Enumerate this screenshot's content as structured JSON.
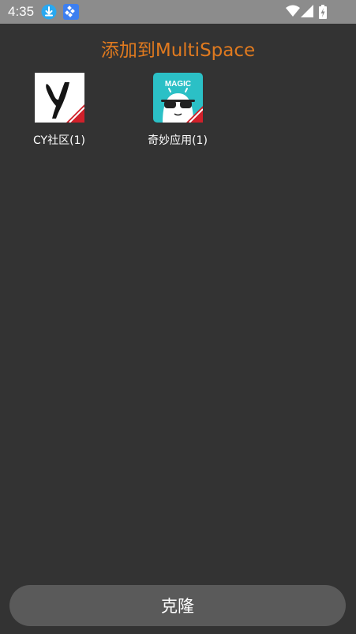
{
  "status_bar": {
    "time": "4:35",
    "icons": [
      "download-icon",
      "app-icon",
      "wifi-icon",
      "signal-icon",
      "battery-icon"
    ]
  },
  "title": "添加到MultiSpace",
  "apps": [
    {
      "label": "CY社区(1)",
      "icon": "cy-app-icon"
    },
    {
      "label": "奇妙应用(1)",
      "icon": "magic-app-icon",
      "icon_text": "MAGIC"
    }
  ],
  "clone_button": {
    "label": "克隆"
  },
  "colors": {
    "background": "#333333",
    "status_bar": "#8c8c8c",
    "title": "#e07a1f",
    "button": "#5a5a5a",
    "magic_icon_bg": "#2bc0c6",
    "badge_red": "#d0202a"
  }
}
